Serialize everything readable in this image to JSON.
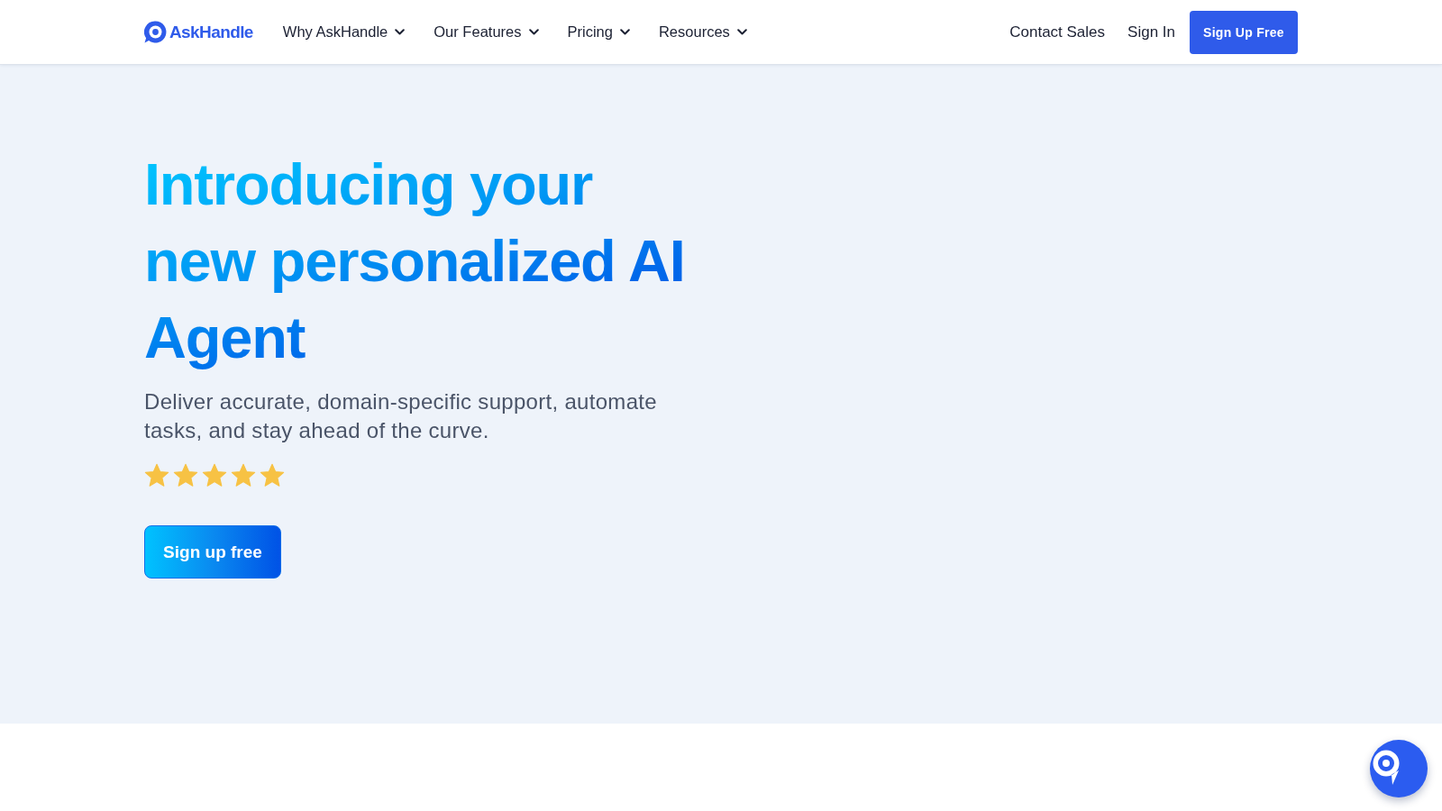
{
  "header": {
    "logo": "AskHandle",
    "nav": [
      {
        "label": "Why AskHandle",
        "dropdown": true
      },
      {
        "label": "Our Features",
        "dropdown": true
      },
      {
        "label": "Pricing",
        "dropdown": true
      },
      {
        "label": "Resources",
        "dropdown": true
      }
    ],
    "links": [
      "Contact Sales",
      "Sign In"
    ],
    "cta": "Sign Up Free"
  },
  "hero": {
    "heading_lines": [
      "Introducing your",
      "new personalized AI",
      "Agent"
    ],
    "subtitle": "Deliver accurate, domain-specific support, automate tasks, and stay ahead of the curve.",
    "rating": {
      "stars": 5
    },
    "cta": "Sign up free"
  }
}
